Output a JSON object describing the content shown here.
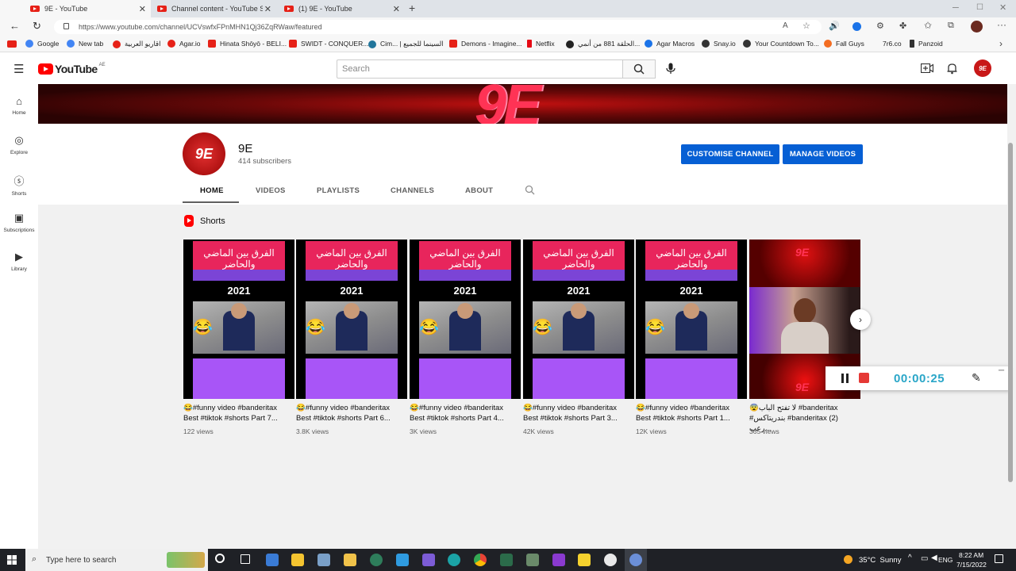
{
  "browser": {
    "tabs": [
      {
        "label": "9E - YouTube",
        "active": true
      },
      {
        "label": "Channel content - YouTube Stu",
        "active": false
      },
      {
        "label": "(1) 9E - YouTube",
        "active": false
      }
    ],
    "url": "https://www.youtube.com/channel/UCVswfxFPnMHN1Qj36ZqRWaw/featured",
    "bookmarks": [
      {
        "label": "Google",
        "color": "#4285f4"
      },
      {
        "label": "New tab",
        "color": "#4285f4"
      },
      {
        "label": "اقاريو العربية",
        "color": "#e62117"
      },
      {
        "label": "Agar.io",
        "color": "#e62117"
      },
      {
        "label": "Hinata Shōyō - BELI...",
        "color": "#e62117"
      },
      {
        "label": "SWIDT - CONQUER...",
        "color": "#e62117"
      },
      {
        "label": "Cim... | السينما للجميع",
        "color": "#21759b"
      },
      {
        "label": "Demons - Imagine...",
        "color": "#e62117"
      },
      {
        "label": "Netflix",
        "color": "#e50914"
      },
      {
        "label": "الحلقة 881 من أنمي...",
        "color": "#222"
      },
      {
        "label": "Agar Macros",
        "color": "#1a73e8"
      },
      {
        "label": "Snay.io",
        "color": "#333"
      },
      {
        "label": "Your Countdown To...",
        "color": "#333"
      },
      {
        "label": "Fall Guys",
        "color": "#f36d21"
      },
      {
        "label": "7r6.co",
        "color": "#888"
      },
      {
        "label": "Panzoid",
        "color": "#333"
      }
    ]
  },
  "youtube": {
    "logo_text": "YouTube",
    "region": "AE",
    "search_placeholder": "Search",
    "sidebar": [
      {
        "label": "Home",
        "icon": "home-icon"
      },
      {
        "label": "Explore",
        "icon": "compass-icon"
      },
      {
        "label": "Shorts",
        "icon": "shorts-icon"
      },
      {
        "label": "Subscriptions",
        "icon": "subscriptions-icon"
      },
      {
        "label": "Library",
        "icon": "library-icon"
      }
    ]
  },
  "channel": {
    "banner_text": "9E",
    "avatar_text": "9E",
    "name": "9E",
    "subscribers": "414 subscribers",
    "customise_label": "CUSTOMISE CHANNEL",
    "manage_label": "MANAGE VIDEOS",
    "tabs": [
      "HOME",
      "VIDEOS",
      "PLAYLISTS",
      "CHANNELS",
      "ABOUT"
    ],
    "active_tab": "HOME"
  },
  "shorts_section": {
    "title": "Shorts",
    "items": [
      {
        "title1": "😂#funny video #banderitax",
        "title2": "Best #tiktok #shorts Part 7...",
        "views": "122 views",
        "year": "2021",
        "overlay": "الفرق بين الماضي والحاضر"
      },
      {
        "title1": "😂#funny video #banderitax",
        "title2": "Best #tiktok #shorts Part 6...",
        "views": "3.8K views",
        "year": "2021",
        "overlay": "الفرق بين الماضي والحاضر"
      },
      {
        "title1": "😂#funny video #banderitax",
        "title2": "Best #tiktok #shorts Part 4...",
        "views": "3K views",
        "year": "2021",
        "overlay": "الفرق بين الماضي والحاضر"
      },
      {
        "title1": "😂#funny video #banderitax",
        "title2": "Best #tiktok #shorts Part 3...",
        "views": "42K views",
        "year": "2021",
        "overlay": "الفرق بين الماضي والحاضر"
      },
      {
        "title1": "😂#funny video #banderitax",
        "title2": "Best #tiktok #shorts Part 1...",
        "views": "12K views",
        "year": "2021",
        "overlay": "الفرق بين الماضي والحاضر"
      },
      {
        "title1": "😨لا تفتح الباب #banderitax",
        "title2": "#بندريتاكس #banderitax (2) رعب...",
        "views": "365 views",
        "logo": "9E"
      }
    ]
  },
  "recorder": {
    "time": "00:00:25"
  },
  "taskbar": {
    "search_placeholder": "Type here to search",
    "weather": "35°C  Sunny",
    "lang": "ENG",
    "time": "8:22 AM",
    "date": "7/15/2022"
  }
}
